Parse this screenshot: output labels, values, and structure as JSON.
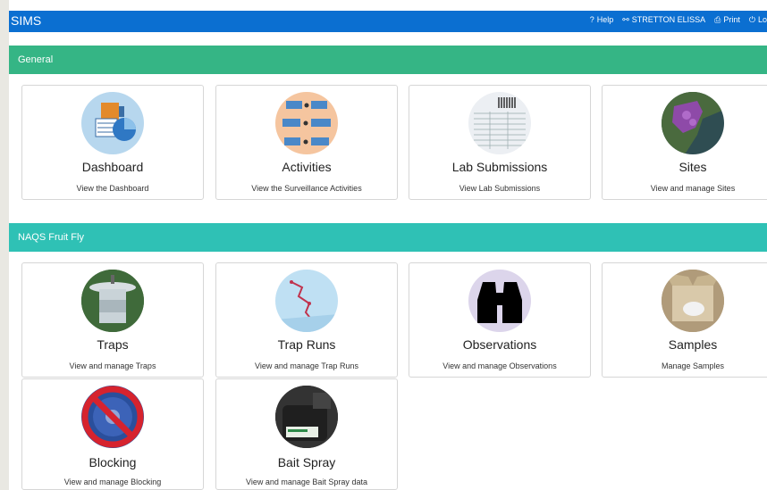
{
  "app": {
    "title": "SIMS"
  },
  "topnav": {
    "help_icon": "help-icon",
    "help": "Help",
    "user_icon": "user-icon",
    "user": "STRETTON ELISSA",
    "print_icon": "print-icon",
    "print": "Print",
    "logout_icon": "power-icon",
    "logout": "Lo"
  },
  "sections": {
    "general": "General",
    "naqs": "NAQS Fruit Fly"
  },
  "general_cards": [
    {
      "title": "Dashboard",
      "desc": "View the Dashboard"
    },
    {
      "title": "Activities",
      "desc": "View the Surveillance Activities"
    },
    {
      "title": "Lab Submissions",
      "desc": "View Lab Submissions"
    },
    {
      "title": "Sites",
      "desc": "View and manage Sites"
    }
  ],
  "naqs_cards": [
    {
      "title": "Traps",
      "desc": "View and manage Traps"
    },
    {
      "title": "Trap Runs",
      "desc": "View and manage Trap Runs"
    },
    {
      "title": "Observations",
      "desc": "View and manage Observations"
    },
    {
      "title": "Samples",
      "desc": "Manage Samples"
    },
    {
      "title": "Blocking",
      "desc": "View and manage Blocking"
    },
    {
      "title": "Bait Spray",
      "desc": "View and manage Bait Spray data"
    }
  ],
  "colors": {
    "topbar": "#0b6fd1",
    "general_bar": "#35b585",
    "naqs_bar": "#2fc1b5"
  }
}
